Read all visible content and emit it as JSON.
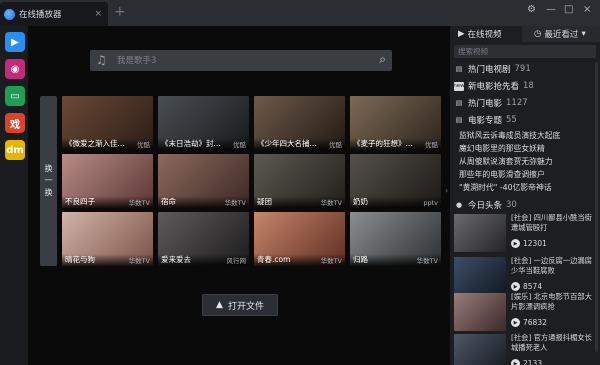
{
  "titlebar": {
    "tab_title": "在线播放器",
    "close_label": "×",
    "new_tab_label": "+",
    "controls": [
      "⚙",
      "—",
      "□",
      "×"
    ]
  },
  "leftbar": {
    "items": [
      {
        "name": "video-app-icon",
        "label": "▶",
        "color": "#2d8cf0"
      },
      {
        "name": "film-reel-icon",
        "label": "◉",
        "color": "#c02c7b"
      },
      {
        "name": "tv-icon",
        "label": "▭",
        "color": "#1f9c55"
      },
      {
        "name": "variety-icon",
        "label": "戏",
        "color": "#d9452c"
      },
      {
        "name": "bullet-comment-icon",
        "label": "dm",
        "color": "#e7b400"
      }
    ]
  },
  "search": {
    "placeholder": "我是歌手3"
  },
  "switch": {
    "chars": [
      "换",
      "一",
      "换"
    ]
  },
  "tiles": [
    {
      "title": "《微爱之渐入佳...",
      "source": "优酷",
      "colors": [
        "#6b4a36",
        "#2a1d17"
      ]
    },
    {
      "title": "《末日浩劫》封...",
      "source": "优酷",
      "colors": [
        "#4a4f54",
        "#17191b"
      ]
    },
    {
      "title": "《少年四大名捕...",
      "source": "优酷",
      "colors": [
        "#6e5a4a",
        "#221914"
      ]
    },
    {
      "title": "《麦子的狂想》...",
      "source": "优酷",
      "colors": [
        "#7d6a55",
        "#2d241d"
      ]
    },
    {
      "title": "不良四子",
      "source": "华数TV",
      "colors": [
        "#b98c87",
        "#5a3633"
      ]
    },
    {
      "title": "宿命",
      "source": "华数TV",
      "colors": [
        "#8d6a5d",
        "#3b2924"
      ]
    },
    {
      "title": "疑团",
      "source": "华数TV",
      "colors": [
        "#5d5a52",
        "#201f1b"
      ]
    },
    {
      "title": "奶奶",
      "source": "pptv",
      "colors": [
        "#55504a",
        "#1b1916"
      ]
    },
    {
      "title": "晴花与狗",
      "source": "华数TV",
      "colors": [
        "#d2b4a8",
        "#7b5147"
      ]
    },
    {
      "title": "爱来爱去",
      "source": "风行网",
      "colors": [
        "#5e5b5d",
        "#1c1b1c"
      ]
    },
    {
      "title": "青春.com",
      "source": "华数TV",
      "colors": [
        "#c9856a",
        "#5c2f22"
      ]
    },
    {
      "title": "归路",
      "source": "华数TV",
      "colors": [
        "#8b8f92",
        "#2c2e30"
      ]
    }
  ],
  "open_file": {
    "label": "打开文件",
    "icon": "▲"
  },
  "sidebar": {
    "tabs": [
      {
        "label": "在线视频",
        "icon": "▶",
        "active": true
      },
      {
        "label": "最近看过",
        "icon": "◷",
        "active": false,
        "arrow": "▾"
      }
    ],
    "filter_placeholder": "搜索视频",
    "categories": [
      {
        "icon": "▤",
        "label": "热门电视剧",
        "count": "791"
      },
      {
        "icon": "new",
        "label": "新电影抢先看",
        "count": "18"
      },
      {
        "icon": "▤",
        "label": "热门电影",
        "count": "1127"
      },
      {
        "icon": "▤",
        "label": "电影专题",
        "count": "55"
      }
    ],
    "topics": [
      "监狱风云诉毒成员演技大起底",
      "魔幻电影里的那些女妖精",
      "从周傻默说演套贾无弥魅力",
      "那些年的电影滑查调擦户",
      "\"黄溯时代\" -40亿影帝神话"
    ],
    "news_header": {
      "icon": "●",
      "label": "今日头条",
      "count": "30"
    },
    "news": [
      {
        "title": "[社会] 四川鄙县小酰当街遭城管殴打",
        "plays": "12301",
        "colors": [
          "#6b6b6e",
          "#242426"
        ]
      },
      {
        "title": "[社会] 一边反腐一边漏腐少华当鞋腐败",
        "plays": "8574",
        "colors": [
          "#3c4f68",
          "#111820"
        ]
      },
      {
        "title": "[娱乐] 北京电影节百部大片影漂调疯抢",
        "plays": "76832",
        "colors": [
          "#9b7c7a",
          "#3a2a29"
        ]
      },
      {
        "title": "[社会] 官方通报抖楣女长城播死老人",
        "plays": "2133",
        "colors": [
          "#4f5865",
          "#151920"
        ]
      }
    ]
  }
}
